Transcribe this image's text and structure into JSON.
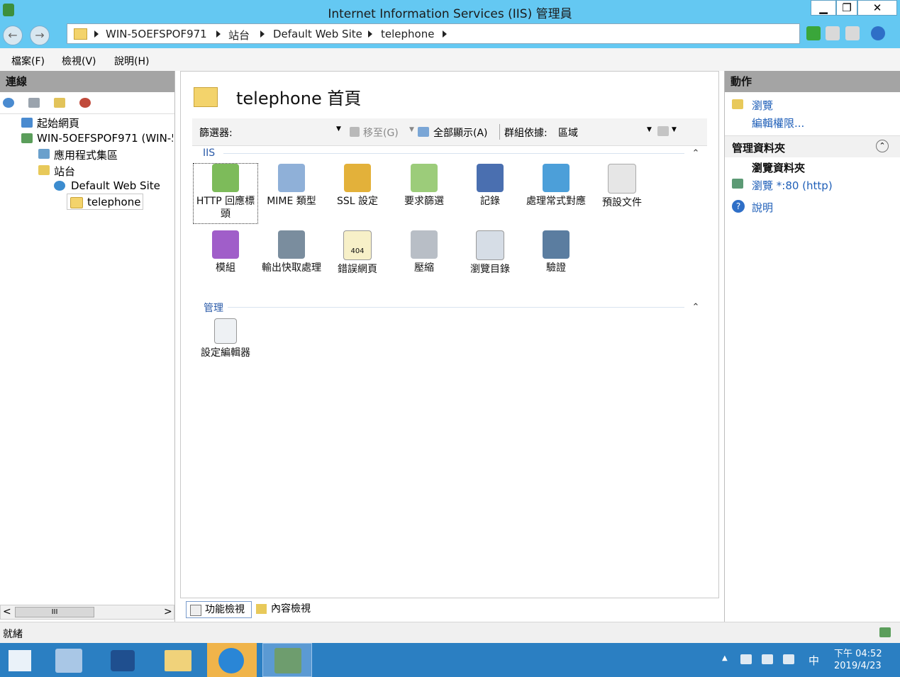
{
  "window": {
    "title": "Internet Information Services (IIS) 管理員",
    "min_glyph": "▁",
    "restore_glyph": "❐",
    "close_glyph": "✕"
  },
  "address": {
    "back_glyph": "←",
    "forward_glyph": "→",
    "crumbs": [
      "WIN-5OEFSPOF971",
      "站台",
      "Default Web Site",
      "telephone"
    ]
  },
  "menubar": {
    "items": [
      "檔案(F)",
      "檢視(V)",
      "說明(H)"
    ]
  },
  "left": {
    "title": "連線",
    "tree": [
      "起始網頁",
      "WIN-5OEFSPOF971 (WIN-5",
      "應用程式集區",
      "站台",
      "Default Web Site",
      "telephone"
    ],
    "scroll_left": "<",
    "scroll_right": ">",
    "scroll_grip": "III"
  },
  "center": {
    "title": "telephone 首頁",
    "filter_label": "篩選器:",
    "goto_label": "移至(G)",
    "showall_label": "全部顯示(A)",
    "group_label": "群組依據:",
    "group_value": "區域",
    "sections": [
      {
        "name": "IIS",
        "features": [
          {
            "label": "HTTP 回應標頭",
            "icon": "http-response-headers-icon"
          },
          {
            "label": "MIME 類型",
            "icon": "mime-types-icon"
          },
          {
            "label": "SSL 設定",
            "icon": "ssl-lock-icon"
          },
          {
            "label": "要求篩選",
            "icon": "request-filtering-icon"
          },
          {
            "label": "記錄",
            "icon": "logging-icon"
          },
          {
            "label": "處理常式對應",
            "icon": "handler-mappings-icon"
          },
          {
            "label": "預設文件",
            "icon": "default-document-icon"
          },
          {
            "label": "模組",
            "icon": "modules-icon"
          },
          {
            "label": "輸出快取處理",
            "icon": "output-caching-icon"
          },
          {
            "label": "錯誤網頁",
            "icon": "error-pages-icon"
          },
          {
            "label": "壓縮",
            "icon": "compression-icon"
          },
          {
            "label": "瀏覽目錄",
            "icon": "directory-browsing-icon"
          },
          {
            "label": "驗證",
            "icon": "authentication-icon"
          }
        ]
      },
      {
        "name": "管理",
        "features": [
          {
            "label": "設定編輯器",
            "icon": "configuration-editor-icon"
          }
        ]
      }
    ],
    "error_icon_text": "404",
    "tabs": [
      "功能檢視",
      "內容檢視"
    ]
  },
  "right": {
    "title": "動作",
    "actions_top": [
      "瀏覽",
      "編輯權限..."
    ],
    "manage_header": "管理資料夾",
    "browse_header": "瀏覽資料夾",
    "browse_link": "瀏覽 *:80 (http)",
    "help": "說明"
  },
  "status": {
    "text": "就緒"
  },
  "taskbar": {
    "ime": "中",
    "time": "下午 04:52",
    "date": "2019/4/23"
  },
  "colors": {
    "titlebar": "#64c8f2",
    "taskbar": "#2b7fc2",
    "link": "#1f5fb8",
    "section": "#2a5aa8"
  }
}
